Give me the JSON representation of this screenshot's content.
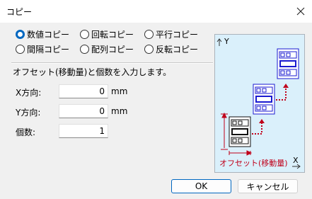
{
  "window": {
    "title": "コピー"
  },
  "copy_modes": [
    {
      "label": "数値コピー",
      "checked": true
    },
    {
      "label": "回転コピー",
      "checked": false
    },
    {
      "label": "平行コピー",
      "checked": false
    },
    {
      "label": "間隔コピー",
      "checked": false
    },
    {
      "label": "配列コピー",
      "checked": false
    },
    {
      "label": "反転コピー",
      "checked": false
    }
  ],
  "description": "オフセット(移動量)と個数を入力します。",
  "fields": {
    "x": {
      "label": "X方向:",
      "value": "0",
      "unit": "mm"
    },
    "y": {
      "label": "Y方向:",
      "value": "0",
      "unit": "mm"
    },
    "count": {
      "label": "個数:",
      "value": "1"
    }
  },
  "preview": {
    "y_axis_label": "Y",
    "x_axis_label": "X",
    "offset_label": "オフセット(移動量)",
    "accent_color": "#c0001a",
    "part_color": "#1a1ad0",
    "background": "#daf0fb"
  },
  "buttons": {
    "ok": "OK",
    "cancel": "キャンセル"
  }
}
